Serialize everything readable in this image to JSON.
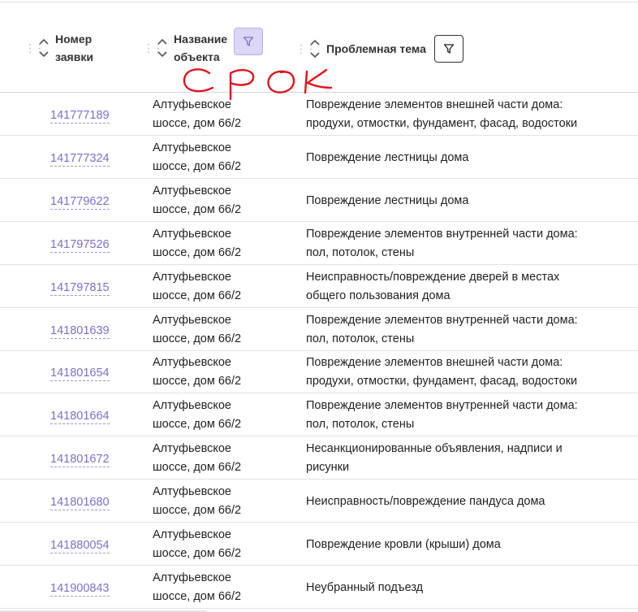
{
  "columns": {
    "number": {
      "label_line1": "Номер",
      "label_line2": "заявки"
    },
    "object": {
      "label_line1": "Название",
      "label_line2": "объекта",
      "filter_active": true
    },
    "topic": {
      "label": "Проблемная тема",
      "filter_active": false
    }
  },
  "annotation": {
    "text": "срок",
    "color": "#e0141e"
  },
  "accent_color": "#7a70cc",
  "rows": [
    {
      "id": "141777189",
      "addr1": "Алтуфьевское",
      "addr2": "шоссе, дом 66/2",
      "topic1": "Повреждение элементов внешней части дома:",
      "topic2": "продухи, отмостки, фундамент, фасад, водостоки"
    },
    {
      "id": "141777324",
      "addr1": "Алтуфьевское",
      "addr2": "шоссе, дом 66/2",
      "topic1": "Повреждение лестницы дома",
      "topic2": ""
    },
    {
      "id": "141779622",
      "addr1": "Алтуфьевское",
      "addr2": "шоссе, дом 66/2",
      "topic1": "Повреждение лестницы дома",
      "topic2": ""
    },
    {
      "id": "141797526",
      "addr1": "Алтуфьевское",
      "addr2": "шоссе, дом 66/2",
      "topic1": "Повреждение элементов внутренней части дома:",
      "topic2": "пол, потолок, стены"
    },
    {
      "id": "141797815",
      "addr1": "Алтуфьевское",
      "addr2": "шоссе, дом 66/2",
      "topic1": "Неисправность/повреждение дверей в местах",
      "topic2": "общего пользования дома"
    },
    {
      "id": "141801639",
      "addr1": "Алтуфьевское",
      "addr2": "шоссе, дом 66/2",
      "topic1": "Повреждение элементов внутренней части дома:",
      "topic2": "пол, потолок, стены"
    },
    {
      "id": "141801654",
      "addr1": "Алтуфьевское",
      "addr2": "шоссе, дом 66/2",
      "topic1": "Повреждение элементов внешней части дома:",
      "topic2": "продухи, отмостки, фундамент, фасад, водостоки"
    },
    {
      "id": "141801664",
      "addr1": "Алтуфьевское",
      "addr2": "шоссе, дом 66/2",
      "topic1": "Повреждение элементов внутренней части дома:",
      "topic2": "пол, потолок, стены"
    },
    {
      "id": "141801672",
      "addr1": "Алтуфьевское",
      "addr2": "шоссе, дом 66/2",
      "topic1": "Несанкционированные объявления, надписи и",
      "topic2": "рисунки"
    },
    {
      "id": "141801680",
      "addr1": "Алтуфьевское",
      "addr2": "шоссе, дом 66/2",
      "topic1": "Неисправность/повреждение пандуса дома",
      "topic2": ""
    },
    {
      "id": "141880054",
      "addr1": "Алтуфьевское",
      "addr2": "шоссе, дом 66/2",
      "topic1": "Повреждение кровли (крыши) дома",
      "topic2": ""
    },
    {
      "id": "141900843",
      "addr1": "Алтуфьевское",
      "addr2": "шоссе, дом 66/2",
      "topic1": "Неубранный подъезд",
      "topic2": ""
    }
  ]
}
